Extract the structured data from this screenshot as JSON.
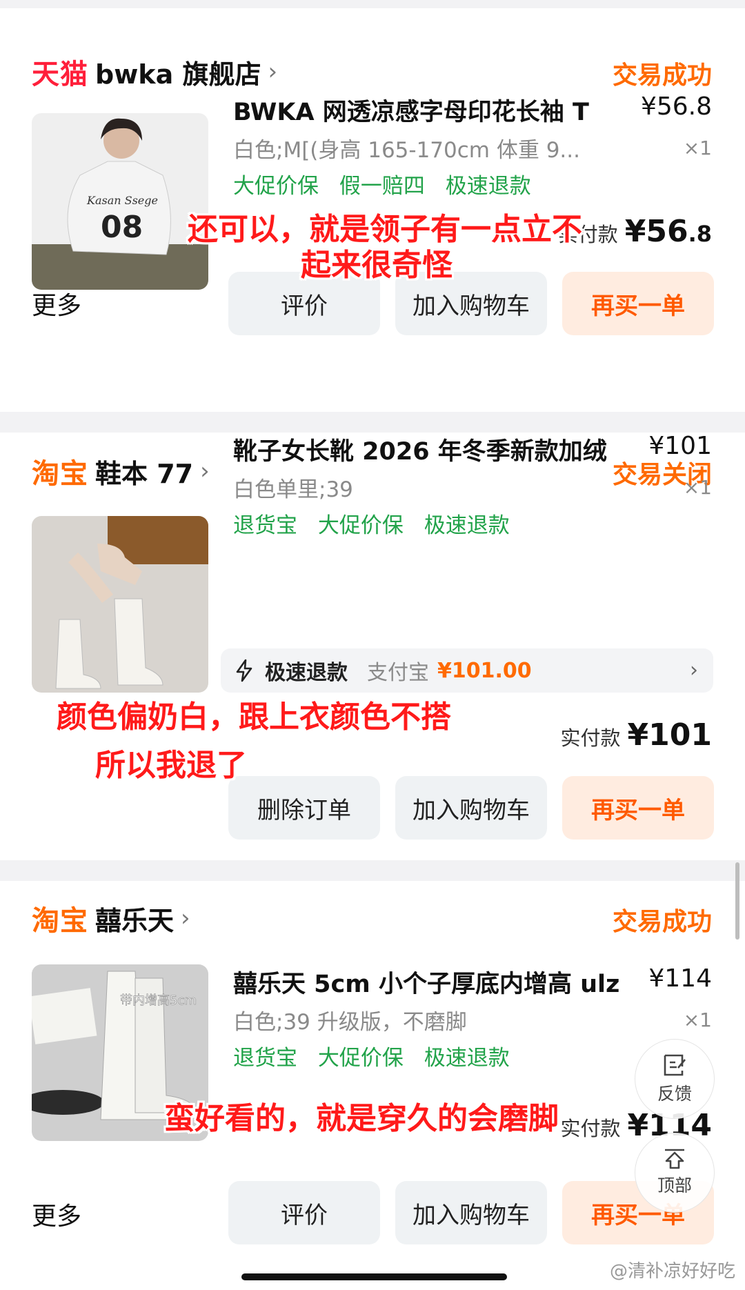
{
  "orders": [
    {
      "brand": "天猫",
      "shop": "bwka 旗舰店",
      "status": "交易成功",
      "title": "BWKA 网透凉感字母印花长袖 T",
      "price": "¥56.8",
      "spec": "白色;M[(身高 165-170cm 体重 9...",
      "qty": "×1",
      "tags": [
        "大促价保",
        "假一赔四",
        "极速退款"
      ],
      "paid_label": "实付款",
      "paid_main": "¥56",
      "paid_dec": ".8",
      "more": "更多",
      "buttons": [
        "评价",
        "加入购物车",
        "再买一单"
      ],
      "note_lines": [
        "还可以，就是领子有一点立不",
        "起来很奇怪"
      ]
    },
    {
      "brand": "淘宝",
      "shop": "鞋本 77",
      "status": "交易关闭",
      "title": "靴子女长靴 2026 年冬季新款加绒",
      "price": "¥101",
      "spec": "白色单里;39",
      "qty": "×1",
      "tags": [
        "退货宝",
        "大促价保",
        "极速退款"
      ],
      "refund": {
        "label": "极速退款",
        "pay": "支付宝",
        "amount": "¥101.00"
      },
      "paid_label": "实付款",
      "paid_main": "¥101",
      "buttons": [
        "删除订单",
        "加入购物车",
        "再买一单"
      ],
      "note_lines": [
        "颜色偏奶白，跟上衣颜色不搭",
        "所以我退了"
      ]
    },
    {
      "brand": "淘宝",
      "shop": "囍乐天",
      "status": "交易成功",
      "title": "囍乐天 5cm 小个子厚底内增高 ulz",
      "price": "¥114",
      "spec": "白色;39 升级版，不磨脚",
      "qty": "×1",
      "tags": [
        "退货宝",
        "大促价保",
        "极速退款"
      ],
      "thumb_text": "带内增高5cm",
      "paid_label": "实付款",
      "paid_main": "¥114",
      "more": "更多",
      "buttons": [
        "评价",
        "加入购物车",
        "再买一单"
      ],
      "note_lines": [
        "蛮好看的，就是穿久的会磨脚"
      ]
    }
  ],
  "float": {
    "feedback": "反馈",
    "top": "顶部"
  },
  "watermark": "@清补凉好好吃",
  "colors": {
    "accent": "#ff6a00",
    "tmall": "#ff1f3a",
    "tag_green": "#22a34a",
    "note_red": "#ff1a1a"
  }
}
